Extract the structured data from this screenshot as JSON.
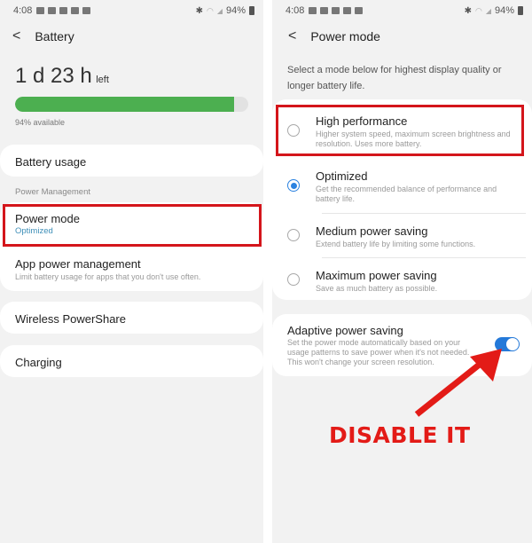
{
  "status_bar": {
    "time": "4:08",
    "battery": "94%",
    "left_icons": [
      "message-icon",
      "calendar-icon",
      "translate-icon",
      "fan-icon",
      "gallery-icon"
    ],
    "right_icons": [
      "bluetooth-icon",
      "wifi-icon",
      "signal-icon",
      "battery-icon"
    ]
  },
  "left_screen": {
    "title": "Battery",
    "time_left": {
      "value": "1 d 23 h",
      "suffix": "left"
    },
    "battery_level_percent": 94,
    "available_text": "94% available",
    "battery_usage": "Battery usage",
    "section_header": "Power Management",
    "power_mode": {
      "title": "Power mode",
      "value": "Optimized"
    },
    "app_power": {
      "title": "App power management",
      "subtitle": "Limit battery usage for apps that you don't use often."
    },
    "wireless_powershare": "Wireless PowerShare",
    "charging": "Charging"
  },
  "right_screen": {
    "title": "Power mode",
    "description": "Select a mode below for highest display quality or longer battery life.",
    "modes": [
      {
        "title": "High performance",
        "subtitle": "Higher system speed, maximum screen brightness and resolution. Uses more battery.",
        "selected": false
      },
      {
        "title": "Optimized",
        "subtitle": "Get the recommended balance of performance and battery life.",
        "selected": true
      },
      {
        "title": "Medium power saving",
        "subtitle": "Extend battery life by limiting some functions.",
        "selected": false
      },
      {
        "title": "Maximum power saving",
        "subtitle": "Save as much battery as possible.",
        "selected": false
      }
    ],
    "adaptive": {
      "title": "Adaptive power saving",
      "subtitle": "Set the power mode automatically based on your usage patterns to save power when it's not needed. This won't change your screen resolution.",
      "enabled": true
    }
  },
  "annotation": {
    "callout_text": "DISABLE IT",
    "color": "#e31b17"
  },
  "colors": {
    "battery_bar": "#4caf50",
    "accent_blue": "#2479d9",
    "highlight_red": "#d4151b"
  }
}
